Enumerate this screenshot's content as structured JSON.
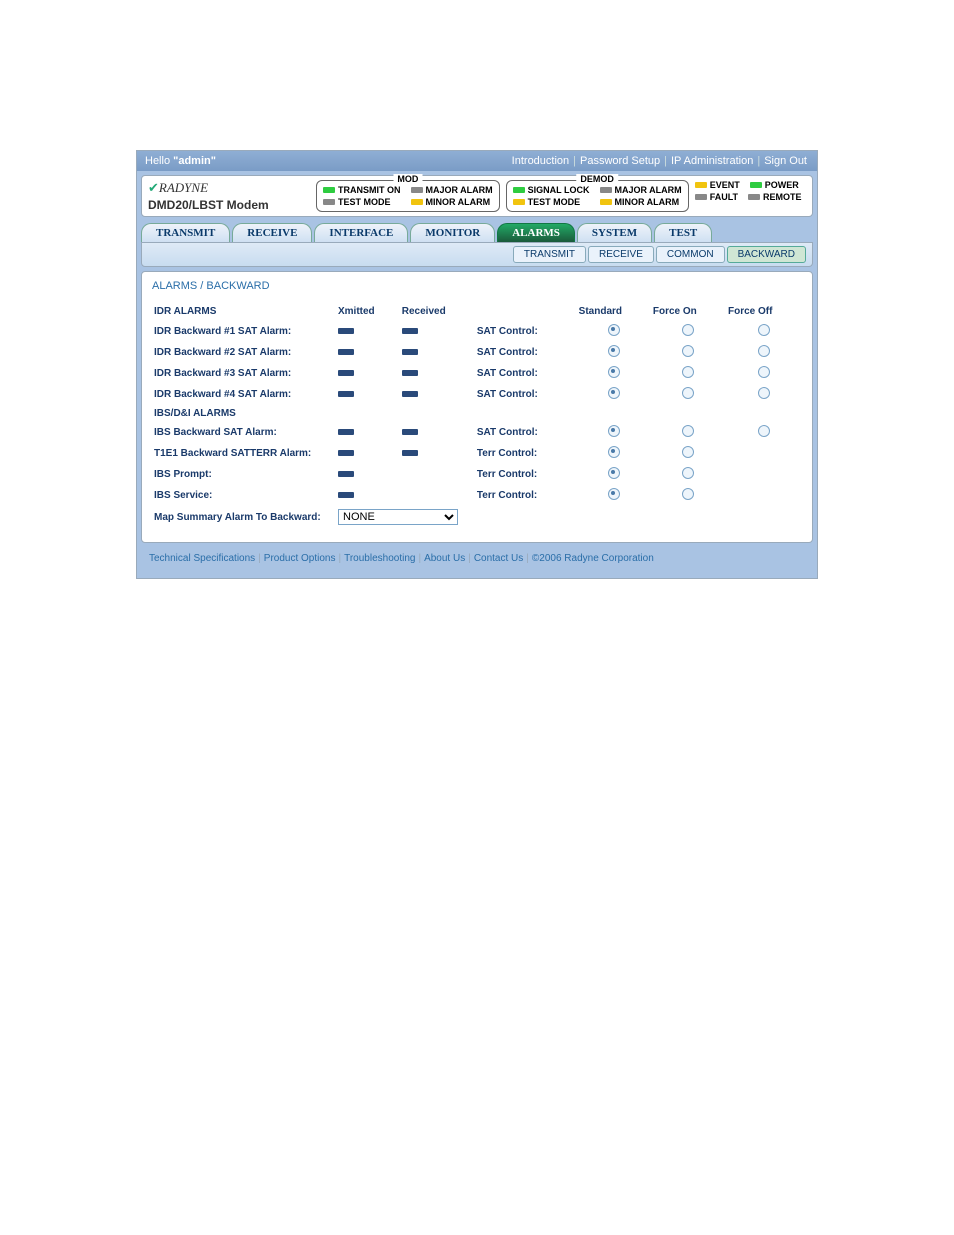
{
  "topbar": {
    "greet_prefix": "Hello ",
    "greet_user": "\"admin\"",
    "links": [
      "Introduction",
      "Password Setup",
      "IP Administration",
      "Sign Out"
    ]
  },
  "brand": {
    "logo": "RADYNE",
    "model": "DMD20/LBST Modem"
  },
  "status": {
    "mod": {
      "title": "MOD",
      "items_left": [
        {
          "led": "green",
          "label": "TRANSMIT ON"
        },
        {
          "led": "gray",
          "label": "TEST MODE"
        }
      ],
      "items_right": [
        {
          "led": "gray",
          "label": "MAJOR ALARM"
        },
        {
          "led": "yellow",
          "label": "MINOR ALARM"
        }
      ]
    },
    "demod": {
      "title": "DEMOD",
      "items_left": [
        {
          "led": "green",
          "label": "SIGNAL LOCK"
        },
        {
          "led": "yellow",
          "label": "TEST MODE"
        }
      ],
      "items_right": [
        {
          "led": "gray",
          "label": "MAJOR ALARM"
        },
        {
          "led": "yellow",
          "label": "MINOR ALARM"
        }
      ]
    },
    "right": [
      [
        {
          "led": "yellow",
          "label": "EVENT"
        },
        {
          "led": "green",
          "label": "POWER"
        }
      ],
      [
        {
          "led": "gray",
          "label": "FAULT"
        },
        {
          "led": "gray",
          "label": "REMOTE"
        }
      ]
    ]
  },
  "maintabs": [
    "TRANSMIT",
    "RECEIVE",
    "INTERFACE",
    "MONITOR",
    "ALARMS",
    "SYSTEM",
    "TEST"
  ],
  "maintab_active": 4,
  "subtabs": [
    "TRANSMIT",
    "RECEIVE",
    "COMMON",
    "BACKWARD"
  ],
  "subtab_active": 3,
  "breadcrumb": "ALARMS / BACKWARD",
  "table": {
    "section1": "IDR ALARMS",
    "cols": [
      "Xmitted",
      "Received",
      "",
      "Standard",
      "Force On",
      "Force Off"
    ],
    "idr_rows": [
      {
        "label": "IDR Backward #1 SAT Alarm:",
        "ctl": "SAT Control:",
        "r": [
          true,
          false,
          false
        ]
      },
      {
        "label": "IDR Backward #2 SAT Alarm:",
        "ctl": "SAT Control:",
        "r": [
          true,
          false,
          false
        ]
      },
      {
        "label": "IDR Backward #3 SAT Alarm:",
        "ctl": "SAT Control:",
        "r": [
          true,
          false,
          false
        ]
      },
      {
        "label": "IDR Backward #4 SAT Alarm:",
        "ctl": "SAT Control:",
        "r": [
          true,
          false,
          false
        ]
      }
    ],
    "section2": "IBS/D&I ALARMS",
    "ibs_rows": [
      {
        "label": "IBS Backward SAT Alarm:",
        "xmit": true,
        "recv": true,
        "ctl": "SAT Control:",
        "r": [
          true,
          false,
          false
        ]
      },
      {
        "label": "T1E1 Backward SATTERR Alarm:",
        "xmit": true,
        "recv": true,
        "ctl": "Terr Control:",
        "r": [
          true,
          false,
          null
        ]
      },
      {
        "label": "IBS Prompt:",
        "xmit": true,
        "recv": false,
        "ctl": "Terr Control:",
        "r": [
          true,
          false,
          null
        ]
      },
      {
        "label": "IBS Service:",
        "xmit": true,
        "recv": false,
        "ctl": "Terr Control:",
        "r": [
          true,
          false,
          null
        ]
      }
    ],
    "map_label": "Map Summary Alarm To Backward:",
    "map_value": "NONE"
  },
  "footer": {
    "links": [
      "Technical Specifications",
      "Product Options",
      "Troubleshooting",
      "About Us",
      "Contact Us"
    ],
    "copyright": "©2006 Radyne Corporation"
  }
}
